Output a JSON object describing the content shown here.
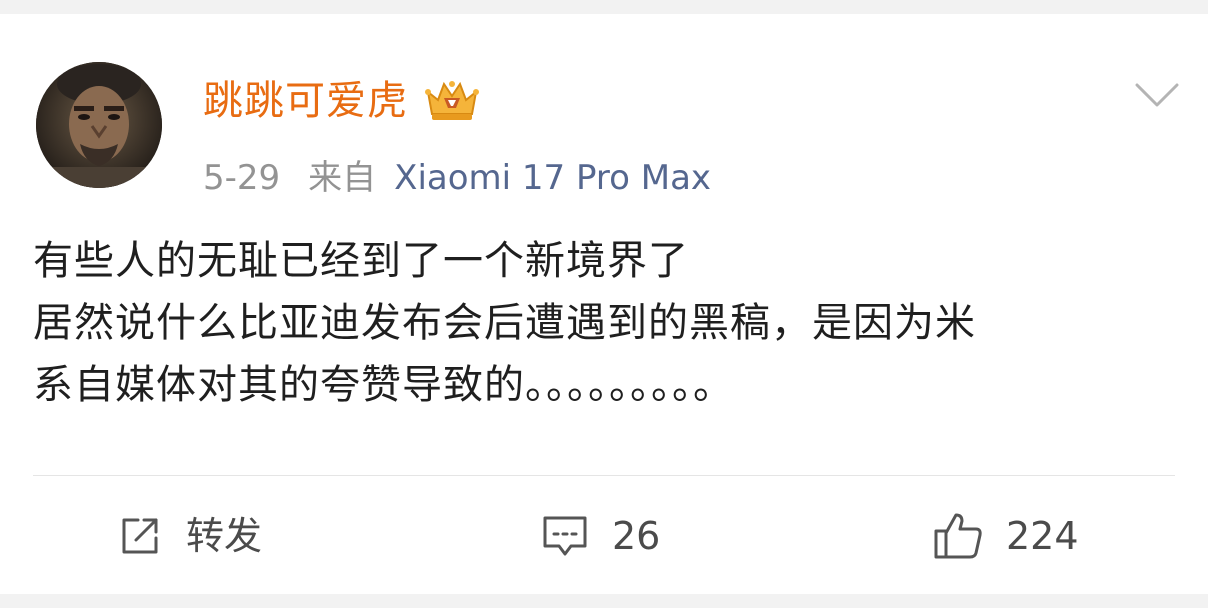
{
  "post": {
    "author": {
      "name": "跳跳可爱虎",
      "name_color": "#e86c12",
      "badge_icon": "vip-crown-badge-icon"
    },
    "meta": {
      "date": "5-29",
      "from_label": "来自",
      "device": "Xiaomi 17 Pro Max"
    },
    "more_icon": "chevron-down-icon",
    "content_lines": [
      "有些人的无耻已经到了一个新境界了",
      "居然说什么比亚迪发布会后遭遇到的黑稿，是因为米",
      "系自媒体对其的夸赞导致的。。。。。。。。。"
    ]
  },
  "actions": {
    "repost": {
      "label": "转发",
      "icon": "repost-icon"
    },
    "comment": {
      "label": "26",
      "icon": "comment-icon"
    },
    "like": {
      "label": "224",
      "icon": "thumbs-up-icon"
    }
  }
}
